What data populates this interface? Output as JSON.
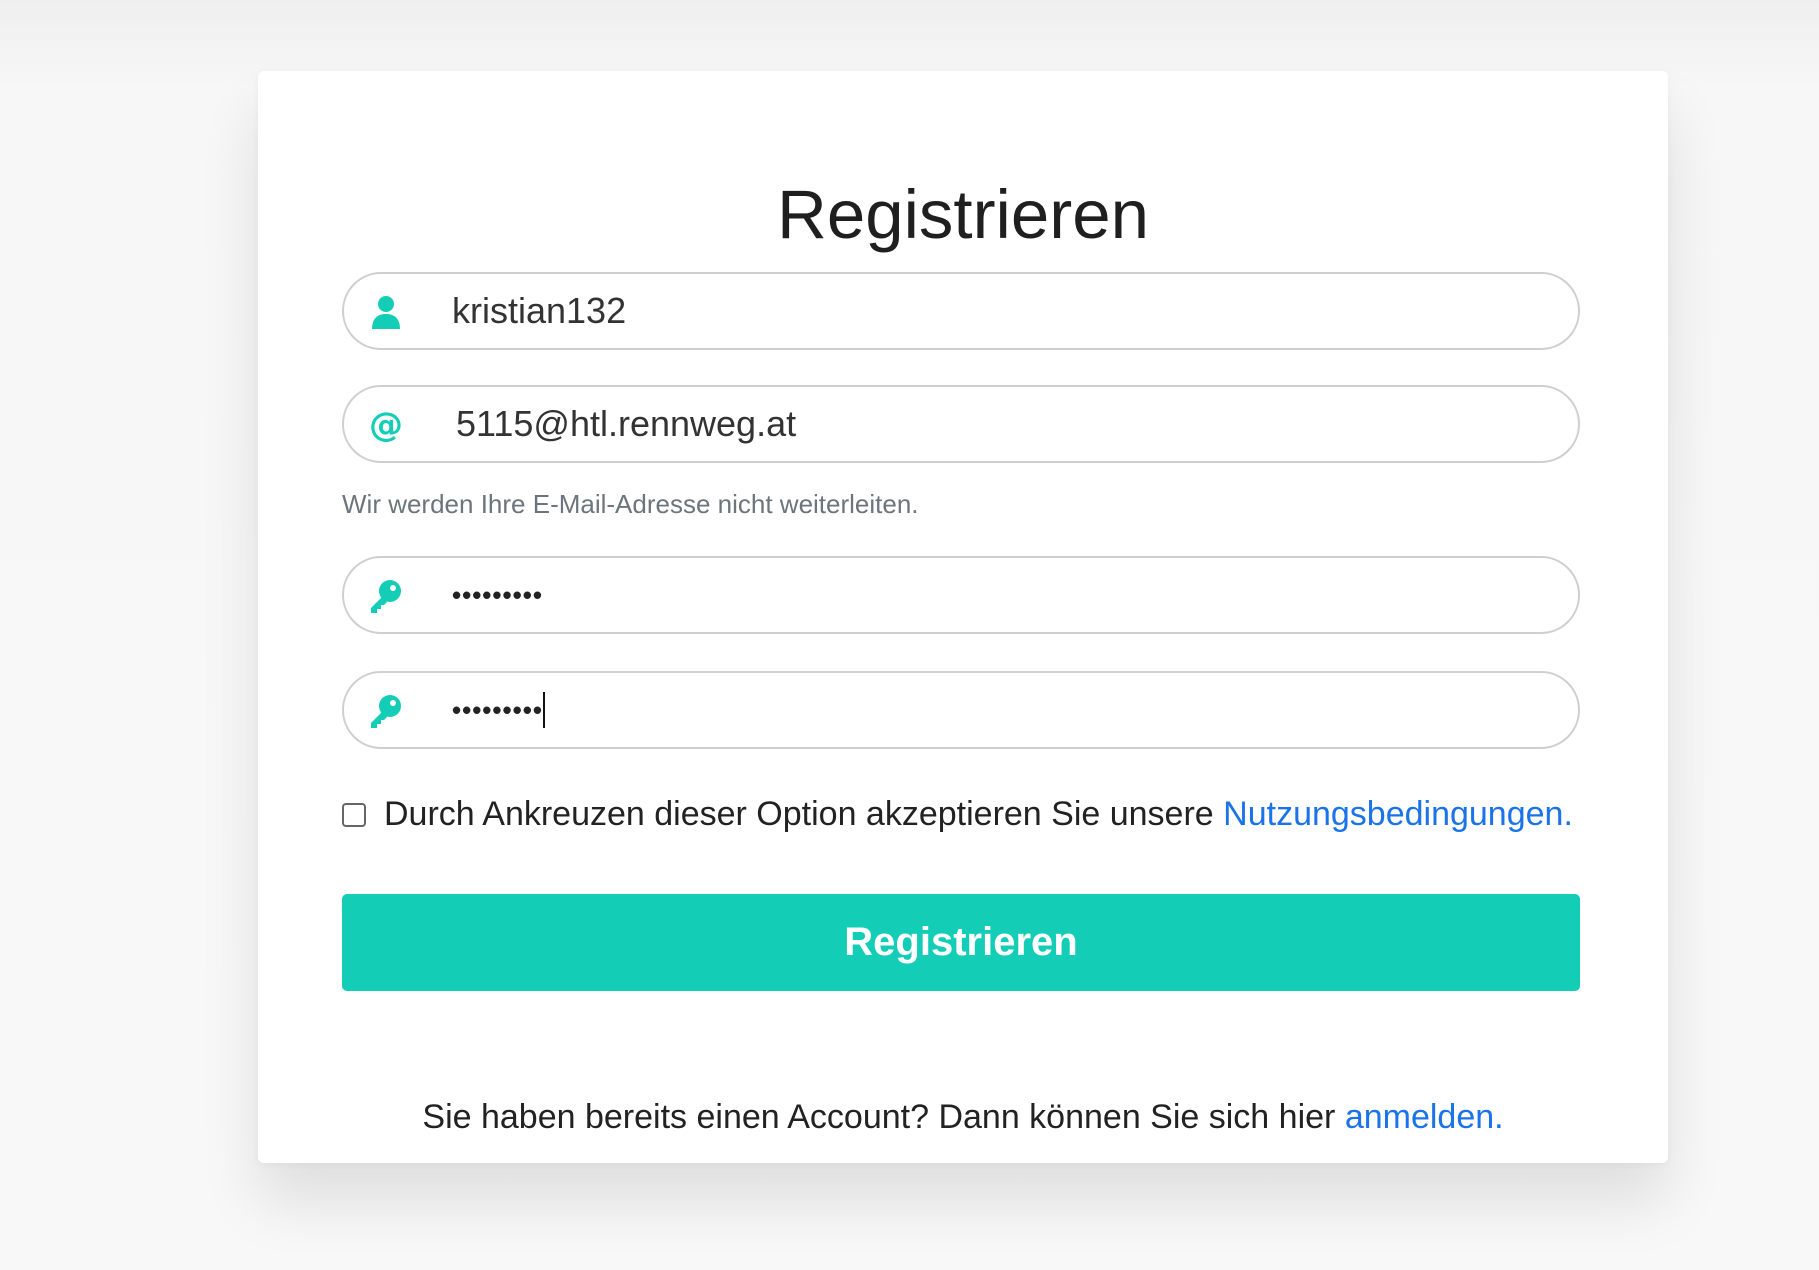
{
  "form": {
    "title": "Registrieren",
    "username": {
      "value": "kristian132",
      "icon": "user-icon"
    },
    "email": {
      "value": "5115@htl.rennweg.at",
      "icon": "at-icon",
      "hint": "Wir werden Ihre E-Mail-Adresse nicht weiterleiten."
    },
    "password": {
      "masked_value": "•••••••••",
      "icon": "key-icon"
    },
    "password_confirm": {
      "masked_value": "•••••••••",
      "icon": "key-icon"
    },
    "terms": {
      "text": "Durch Ankreuzen dieser Option akzeptieren Sie unsere",
      "link_text": "Nutzungsbedingungen.",
      "checked": false
    },
    "submit_label": "Registrieren",
    "login_prompt": {
      "text": "Sie haben bereits einen Account? Dann können Sie sich hier",
      "link_text": "anmelden."
    }
  },
  "colors": {
    "accent": "#13cdb7",
    "link": "#1a73e8",
    "background": "#f7f7f7",
    "card": "#ffffff"
  }
}
